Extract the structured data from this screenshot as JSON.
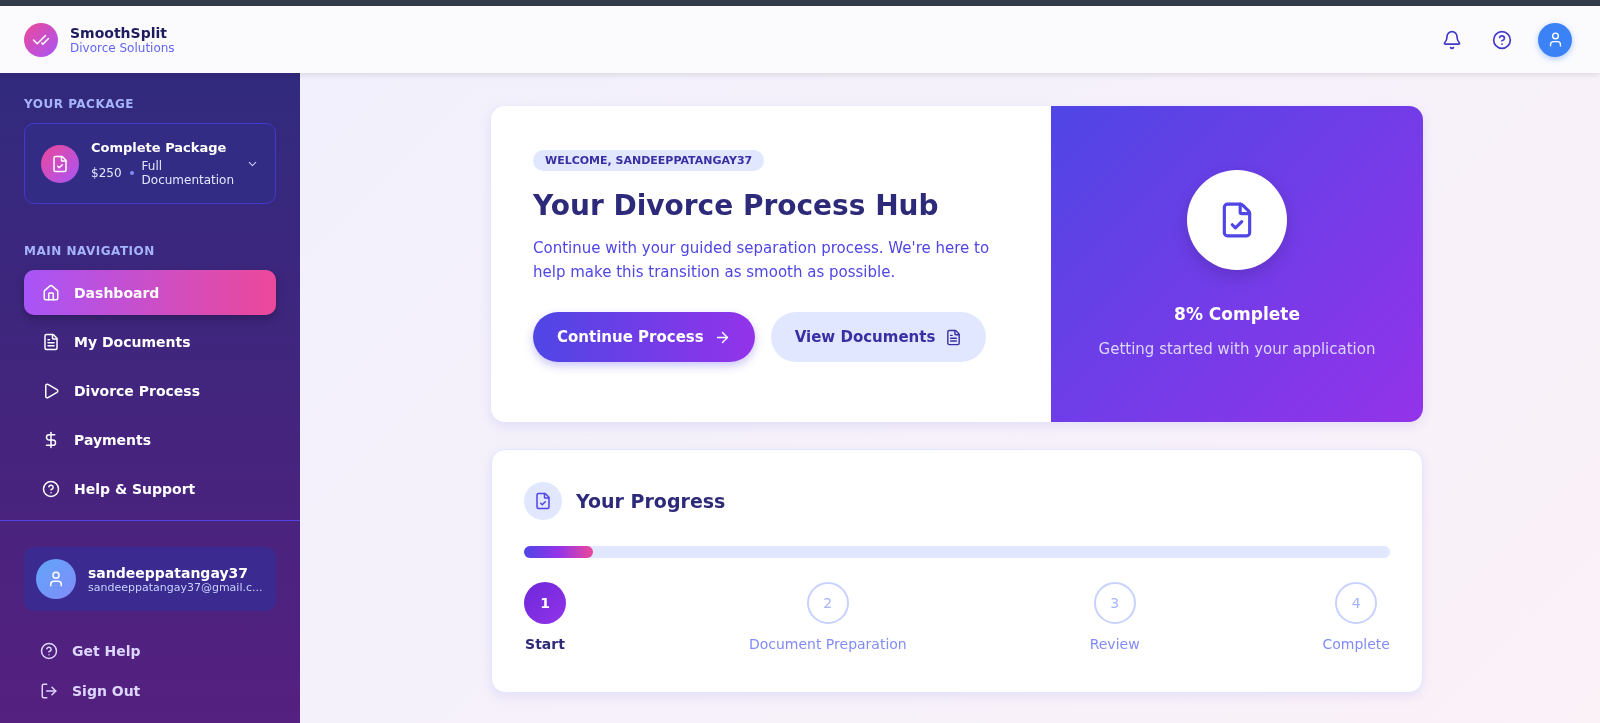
{
  "brand": {
    "name": "SmoothSplit",
    "tagline": "Divorce Solutions"
  },
  "package": {
    "section_label": "YOUR PACKAGE",
    "name": "Complete Package",
    "price": "$250",
    "description": "Full Documentation"
  },
  "navigation": {
    "section_label": "MAIN NAVIGATION",
    "items": [
      {
        "label": "Dashboard",
        "selected": true
      },
      {
        "label": "My Documents",
        "selected": false
      },
      {
        "label": "Divorce Process",
        "selected": false
      },
      {
        "label": "Payments",
        "selected": false
      },
      {
        "label": "Help & Support",
        "selected": false
      }
    ]
  },
  "user": {
    "name": "sandeeppatangay37",
    "email": "sandeeppatangay37@gmail.c..."
  },
  "footer_links": [
    {
      "label": "Get Help"
    },
    {
      "label": "Sign Out"
    }
  ],
  "hero": {
    "badge": "WELCOME, SANDEEPPATANGAY37",
    "title": "Your Divorce Process Hub",
    "description": "Continue with your guided separation process. We're here to help make this transition as smooth as possible.",
    "primary_button": "Continue Process",
    "secondary_button": "View Documents",
    "completion": "8% Complete",
    "status": "Getting started with your application"
  },
  "progress": {
    "title": "Your Progress",
    "level": 0.08,
    "steps": [
      {
        "number": "1",
        "label": "Start",
        "selected": true
      },
      {
        "number": "2",
        "label": "Document Preparation",
        "selected": false
      },
      {
        "number": "3",
        "label": "Review",
        "selected": false
      },
      {
        "number": "4",
        "label": "Complete",
        "selected": false
      }
    ]
  }
}
